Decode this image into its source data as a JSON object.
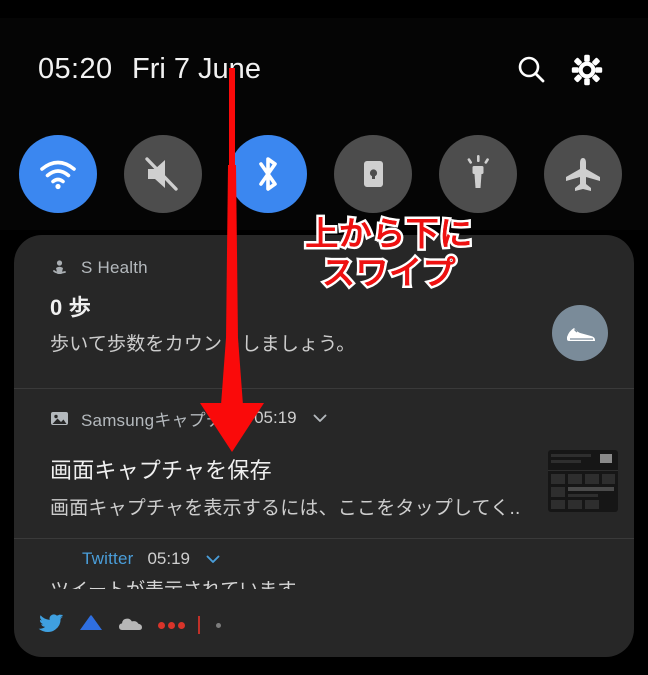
{
  "header": {
    "clock": "05:20",
    "date": "Fri 7 June",
    "search_icon": "search-icon",
    "settings_icon": "gear-icon"
  },
  "quick_settings": {
    "toggles": [
      {
        "name": "wifi",
        "label": "Wi-Fi",
        "state": "on",
        "color": "#3b87f0"
      },
      {
        "name": "sound-mute",
        "label": "Mute",
        "state": "off",
        "color": "#4d4d4d"
      },
      {
        "name": "bluetooth",
        "label": "Bluetooth",
        "state": "on",
        "color": "#3b87f0"
      },
      {
        "name": "auto-rotate-lock",
        "label": "Auto rotate",
        "state": "off",
        "color": "#4d4d4d"
      },
      {
        "name": "flashlight",
        "label": "Flashlight",
        "state": "off",
        "color": "#4d4d4d"
      },
      {
        "name": "airplane-mode",
        "label": "Airplane mode",
        "state": "off",
        "color": "#4d4d4d"
      }
    ]
  },
  "annotation": {
    "line1": "上から下に",
    "line2": "スワイプ",
    "color": "#ee1111",
    "outline_color": "#ffffff",
    "arrow": "down-arrow"
  },
  "notifications": [
    {
      "app": "S Health",
      "app_icon": "shealth-icon",
      "title": "0 歩",
      "body": "歩いて歩数をカウントしましょう。",
      "badge_icon": "sneaker-icon",
      "badge_color": "#7a8b99"
    },
    {
      "app": "Samsungキャプチャ",
      "app_icon": "image-icon",
      "time": "05:19",
      "expand_icon": "chevron-down-icon",
      "title": "画面キャプチャを保存",
      "body": "画面キャプチャを表示するには、ここをタップしてく..",
      "thumbnail": "screenshot-thumbnail"
    },
    {
      "app": "Twitter",
      "app_color": "#4a9eda",
      "time": "05:19",
      "expand_icon": "chevron-down-icon",
      "body": "ツイートが表示されています"
    }
  ],
  "tray": {
    "icons": [
      "twitter-icon",
      "blue-cloud-icon",
      "gray-cloud-icon"
    ],
    "more_indicator": "three-dots-red",
    "status_dot": "gray-dot"
  }
}
